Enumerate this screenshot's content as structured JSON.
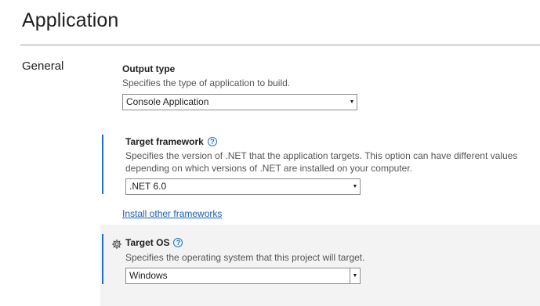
{
  "page": {
    "title": "Application"
  },
  "section": {
    "label": "General"
  },
  "output_type": {
    "title": "Output type",
    "description": "Specifies the type of application to build.",
    "selected": "Console Application"
  },
  "target_framework": {
    "title": "Target framework",
    "description_line1": "Specifies the version of .NET that the application targets. This option can have different values",
    "description_line2": "depending on which versions of .NET are installed on your computer.",
    "selected": ".NET 6.0",
    "help_glyph": "?"
  },
  "install_link": {
    "label": "Install other frameworks"
  },
  "target_os": {
    "title": "Target OS",
    "description": "Specifies the operating system that this project will target.",
    "selected": "Windows",
    "help_glyph": "?"
  },
  "icons": {
    "dropdown_arrow": "chevron-down-icon",
    "help": "help-icon",
    "settings": "gear-icon"
  },
  "colors": {
    "accent": "#1f6fc0",
    "link": "#1a5fb4",
    "shaded_bg": "#f3f3f3"
  }
}
